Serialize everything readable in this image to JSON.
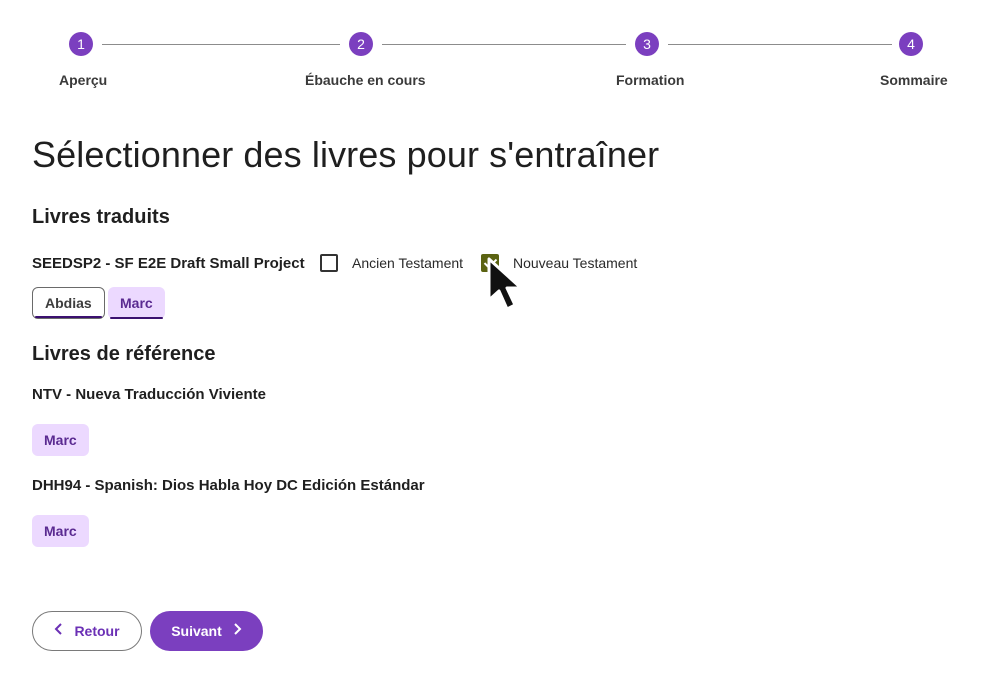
{
  "stepper": {
    "steps": [
      {
        "number": "1",
        "label": "Aperçu"
      },
      {
        "number": "2",
        "label": "Ébauche en cours"
      },
      {
        "number": "3",
        "label": "Formation"
      },
      {
        "number": "4",
        "label": "Sommaire"
      }
    ],
    "accent_color": "#7b3fbf"
  },
  "page_title": "Sélectionner des livres pour s'entraîner",
  "translated": {
    "heading": "Livres traduits",
    "project": "SEEDSP2 - SF E2E Draft Small Project",
    "old_testament_label": "Ancien Testament",
    "old_testament_checked": false,
    "new_testament_label": "Nouveau Testament",
    "new_testament_checked": true,
    "books": [
      "Abdias",
      "Marc"
    ]
  },
  "reference": {
    "heading": "Livres de référence",
    "sources": [
      {
        "name": "NTV - Nueva Traducción Viviente",
        "books": [
          "Marc"
        ]
      },
      {
        "name": "DHH94 - Spanish: Dios Habla Hoy DC Edición Estándar",
        "books": [
          "Marc"
        ]
      }
    ]
  },
  "buttons": {
    "back_label": "Retour",
    "next_label": "Suivant",
    "back_icon": "chevron-left-icon",
    "next_icon": "chevron-right-icon"
  },
  "cursor_icon": "mouse-pointer-icon"
}
